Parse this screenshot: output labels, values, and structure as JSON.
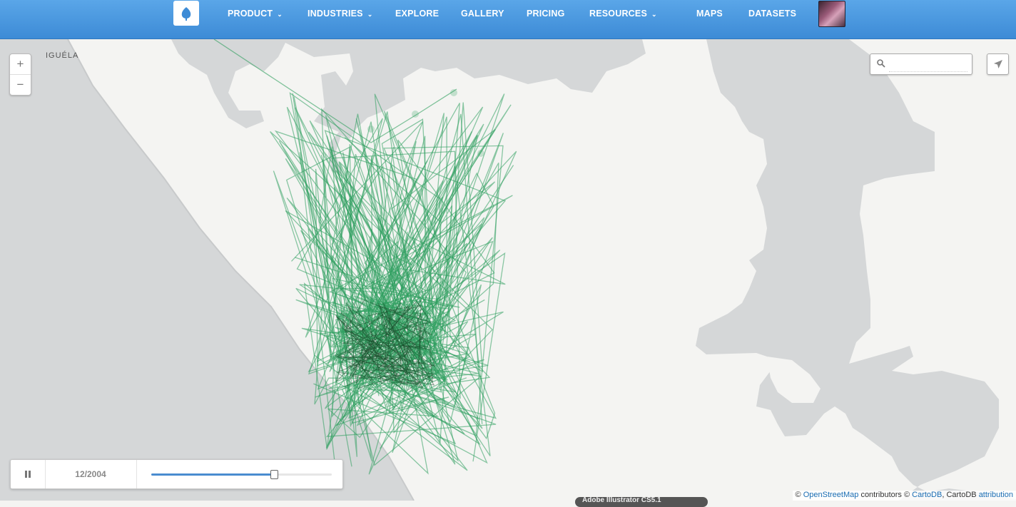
{
  "nav": {
    "items": [
      {
        "label": "PRODUCT",
        "dropdown": true
      },
      {
        "label": "INDUSTRIES",
        "dropdown": true
      },
      {
        "label": "EXPLORE",
        "dropdown": false
      },
      {
        "label": "GALLERY",
        "dropdown": false
      },
      {
        "label": "PRICING",
        "dropdown": false
      },
      {
        "label": "RESOURCES",
        "dropdown": true
      },
      {
        "label": "MAPS",
        "dropdown": false
      },
      {
        "label": "DATASETS",
        "dropdown": false
      }
    ],
    "logo_icon": "cartodb-logo-icon",
    "avatar": "user-avatar"
  },
  "map": {
    "place_label": "IGUÉLA",
    "zoom_in": "+",
    "zoom_out": "−",
    "search": {
      "placeholder": "",
      "value": ""
    },
    "colors": {
      "land": "#f4f4f2",
      "water": "#d5d7d8",
      "track": "#2e9e5e",
      "accent": "#4a8cd0"
    }
  },
  "timeline": {
    "date": "12/2004",
    "progress": 0.68,
    "state": "playing"
  },
  "attribution": {
    "prefix": "©",
    "osm": "OpenStreetMap",
    "middle": "contributors ©",
    "cartodb": "CartoDB",
    "sep": ", CartoDB",
    "attribution": "attribution"
  },
  "badge": {
    "text": "Adobe Illustrator CS5.1"
  }
}
